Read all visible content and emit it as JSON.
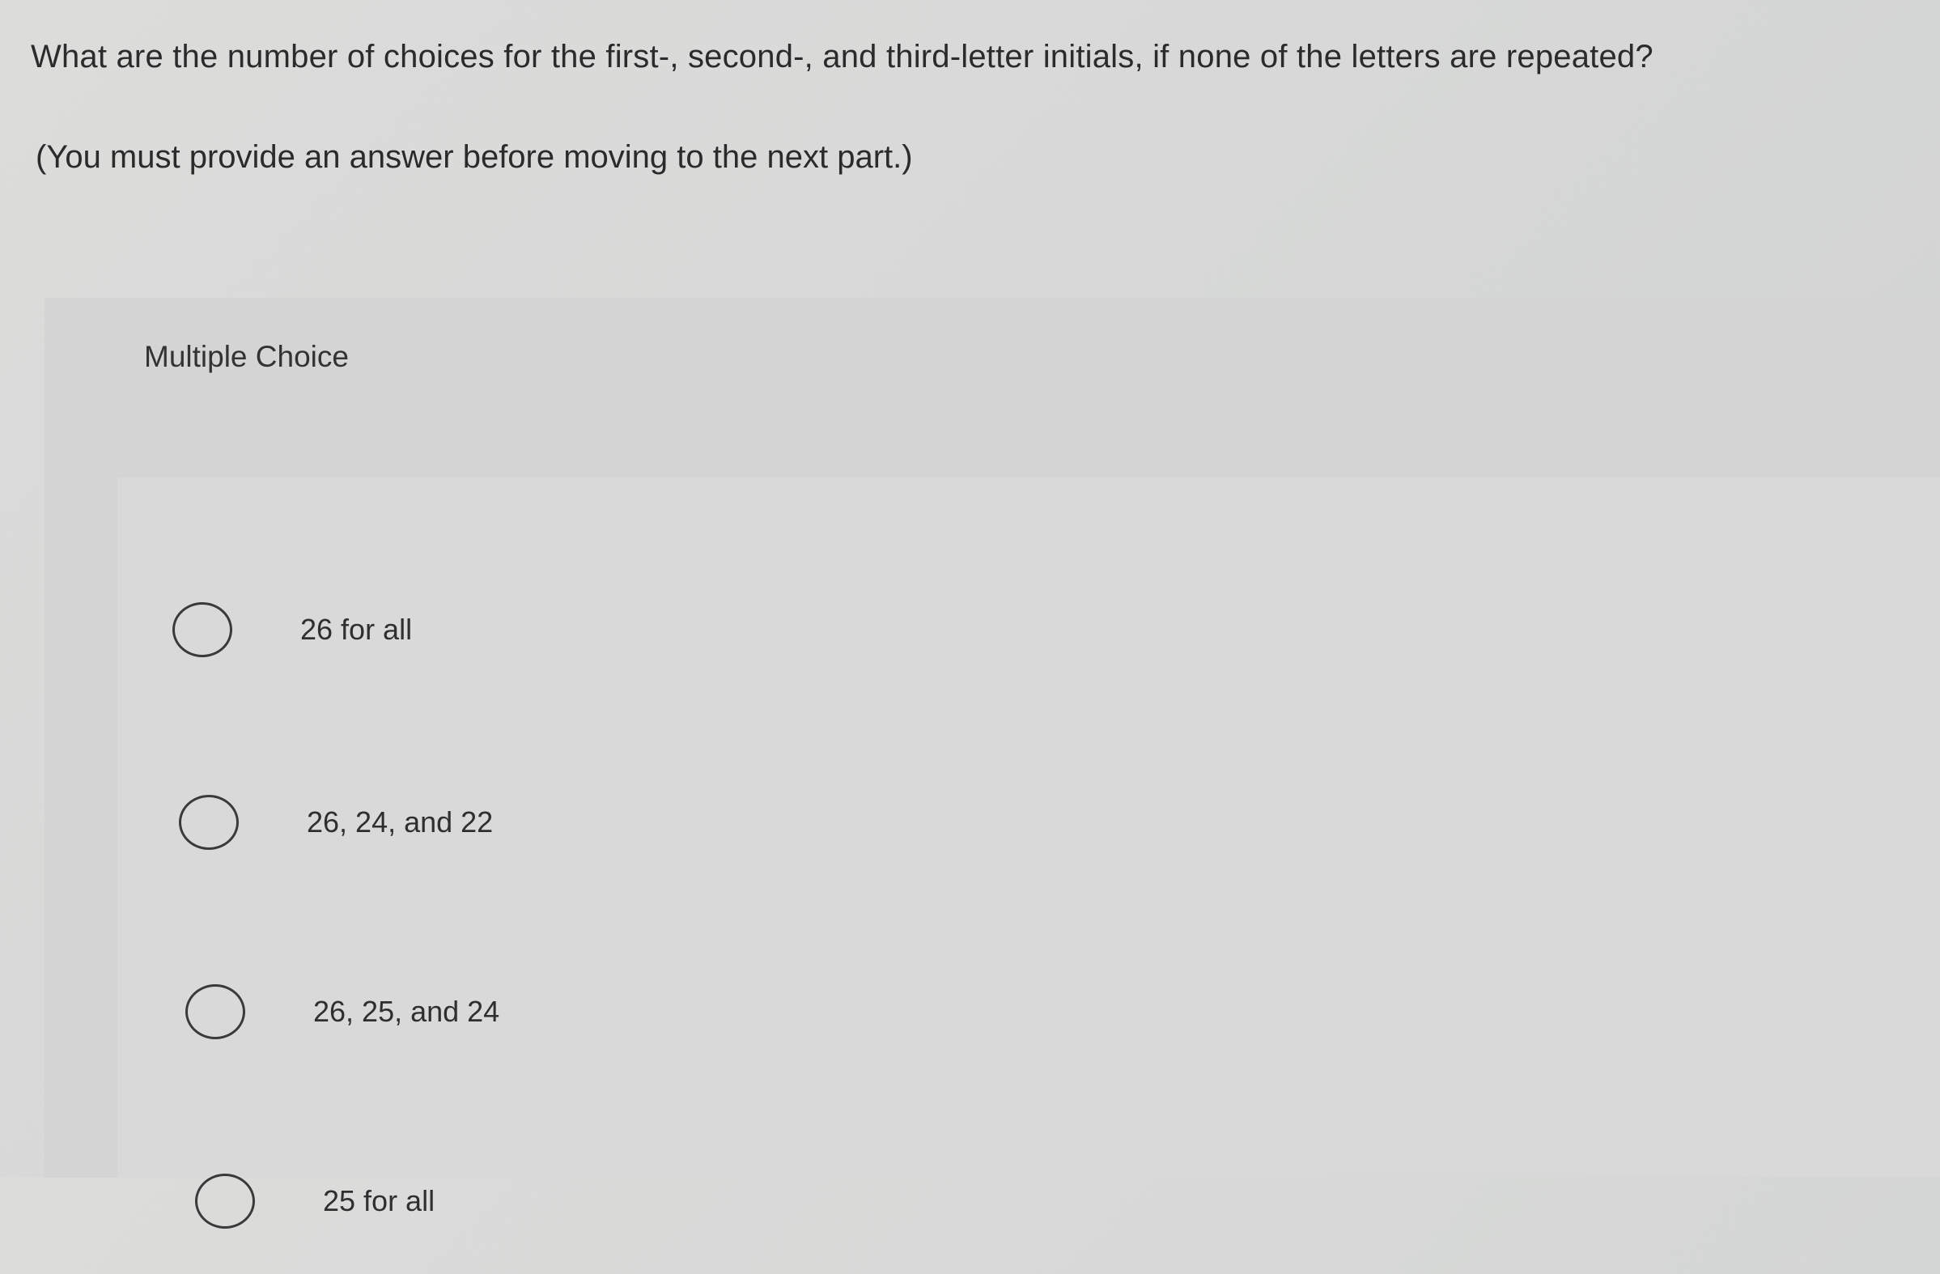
{
  "question": "What are the number of choices for the first-, second-, and third-letter initials, if none of the letters are repeated?",
  "instruction": "(You must provide an answer before moving to the next part.)",
  "multiple_choice": {
    "title": "Multiple Choice",
    "options": [
      {
        "label": "26 for all"
      },
      {
        "label": "26, 24, and 22"
      },
      {
        "label": "26, 25, and 24"
      },
      {
        "label": "25 for all"
      }
    ]
  }
}
